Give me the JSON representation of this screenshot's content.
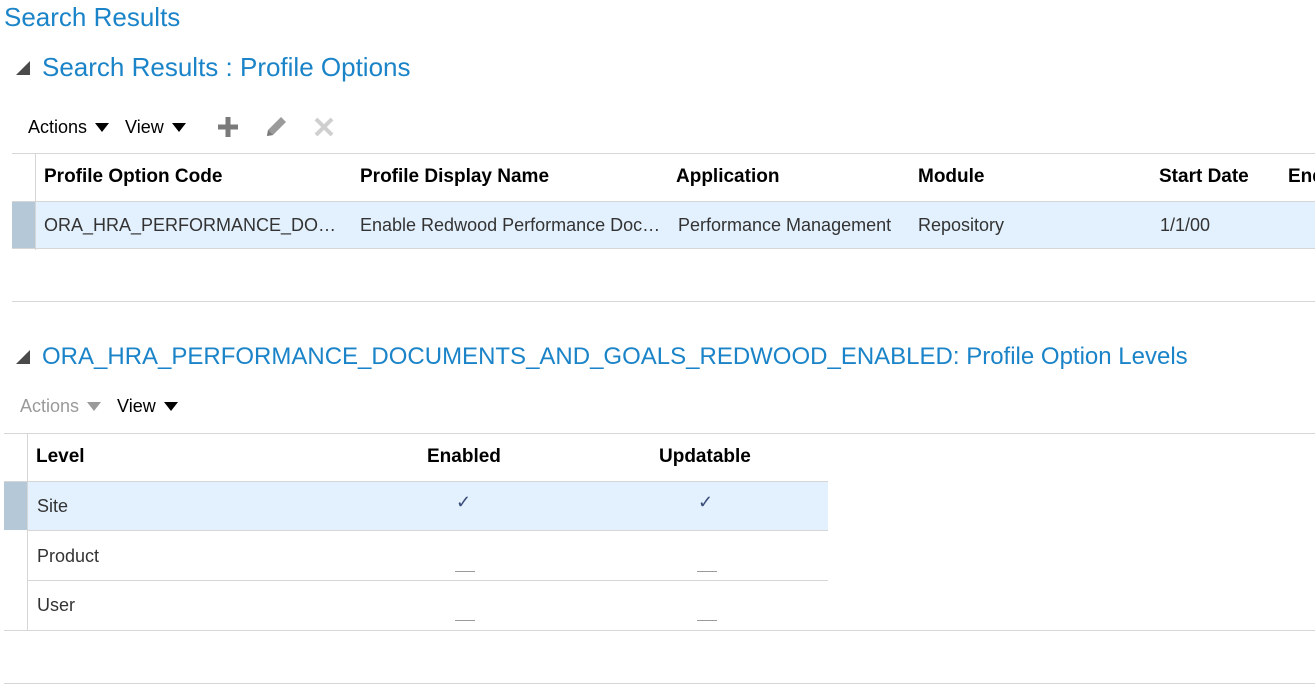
{
  "page": {
    "title": "Search Results"
  },
  "section1": {
    "title": "Search Results : Profile Options",
    "toolbar": {
      "actions_label": "Actions",
      "view_label": "View",
      "icons": [
        "add-icon",
        "edit-icon",
        "delete-icon"
      ]
    },
    "columns": [
      "Profile Option Code",
      "Profile Display Name",
      "Application",
      "Module",
      "Start Date",
      "End"
    ],
    "row": {
      "code": "ORA_HRA_PERFORMANCE_DO…",
      "display_name": "Enable Redwood Performance Doc…",
      "application": "Performance Management",
      "module": "Repository",
      "start_date": "1/1/00"
    }
  },
  "section2": {
    "title": "ORA_HRA_PERFORMANCE_DOCUMENTS_AND_GOALS_REDWOOD_ENABLED: Profile Option Levels",
    "toolbar": {
      "actions_label": "Actions",
      "view_label": "View"
    },
    "columns": [
      "Level",
      "Enabled",
      "Updatable"
    ],
    "rows": [
      {
        "level": "Site",
        "enabled": "✓",
        "updatable": "✓"
      },
      {
        "level": "Product",
        "enabled": "",
        "updatable": ""
      },
      {
        "level": "User",
        "enabled": "",
        "updatable": ""
      }
    ]
  },
  "colors": {
    "link_blue": "#1b84c8",
    "selected_row": "#e3f0fd",
    "selected_bar": "#b4c8d8"
  }
}
